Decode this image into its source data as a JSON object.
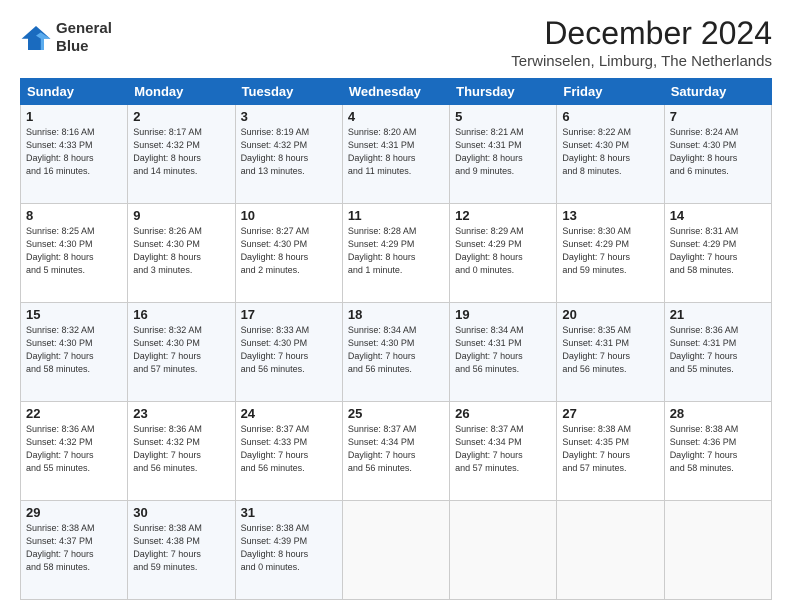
{
  "header": {
    "logo_line1": "General",
    "logo_line2": "Blue",
    "main_title": "December 2024",
    "subtitle": "Terwinselen, Limburg, The Netherlands"
  },
  "calendar": {
    "headers": [
      "Sunday",
      "Monday",
      "Tuesday",
      "Wednesday",
      "Thursday",
      "Friday",
      "Saturday"
    ],
    "weeks": [
      [
        {
          "day": "1",
          "info": "Sunrise: 8:16 AM\nSunset: 4:33 PM\nDaylight: 8 hours\nand 16 minutes."
        },
        {
          "day": "2",
          "info": "Sunrise: 8:17 AM\nSunset: 4:32 PM\nDaylight: 8 hours\nand 14 minutes."
        },
        {
          "day": "3",
          "info": "Sunrise: 8:19 AM\nSunset: 4:32 PM\nDaylight: 8 hours\nand 13 minutes."
        },
        {
          "day": "4",
          "info": "Sunrise: 8:20 AM\nSunset: 4:31 PM\nDaylight: 8 hours\nand 11 minutes."
        },
        {
          "day": "5",
          "info": "Sunrise: 8:21 AM\nSunset: 4:31 PM\nDaylight: 8 hours\nand 9 minutes."
        },
        {
          "day": "6",
          "info": "Sunrise: 8:22 AM\nSunset: 4:30 PM\nDaylight: 8 hours\nand 8 minutes."
        },
        {
          "day": "7",
          "info": "Sunrise: 8:24 AM\nSunset: 4:30 PM\nDaylight: 8 hours\nand 6 minutes."
        }
      ],
      [
        {
          "day": "8",
          "info": "Sunrise: 8:25 AM\nSunset: 4:30 PM\nDaylight: 8 hours\nand 5 minutes."
        },
        {
          "day": "9",
          "info": "Sunrise: 8:26 AM\nSunset: 4:30 PM\nDaylight: 8 hours\nand 3 minutes."
        },
        {
          "day": "10",
          "info": "Sunrise: 8:27 AM\nSunset: 4:30 PM\nDaylight: 8 hours\nand 2 minutes."
        },
        {
          "day": "11",
          "info": "Sunrise: 8:28 AM\nSunset: 4:29 PM\nDaylight: 8 hours\nand 1 minute."
        },
        {
          "day": "12",
          "info": "Sunrise: 8:29 AM\nSunset: 4:29 PM\nDaylight: 8 hours\nand 0 minutes."
        },
        {
          "day": "13",
          "info": "Sunrise: 8:30 AM\nSunset: 4:29 PM\nDaylight: 7 hours\nand 59 minutes."
        },
        {
          "day": "14",
          "info": "Sunrise: 8:31 AM\nSunset: 4:29 PM\nDaylight: 7 hours\nand 58 minutes."
        }
      ],
      [
        {
          "day": "15",
          "info": "Sunrise: 8:32 AM\nSunset: 4:30 PM\nDaylight: 7 hours\nand 58 minutes."
        },
        {
          "day": "16",
          "info": "Sunrise: 8:32 AM\nSunset: 4:30 PM\nDaylight: 7 hours\nand 57 minutes."
        },
        {
          "day": "17",
          "info": "Sunrise: 8:33 AM\nSunset: 4:30 PM\nDaylight: 7 hours\nand 56 minutes."
        },
        {
          "day": "18",
          "info": "Sunrise: 8:34 AM\nSunset: 4:30 PM\nDaylight: 7 hours\nand 56 minutes."
        },
        {
          "day": "19",
          "info": "Sunrise: 8:34 AM\nSunset: 4:31 PM\nDaylight: 7 hours\nand 56 minutes."
        },
        {
          "day": "20",
          "info": "Sunrise: 8:35 AM\nSunset: 4:31 PM\nDaylight: 7 hours\nand 56 minutes."
        },
        {
          "day": "21",
          "info": "Sunrise: 8:36 AM\nSunset: 4:31 PM\nDaylight: 7 hours\nand 55 minutes."
        }
      ],
      [
        {
          "day": "22",
          "info": "Sunrise: 8:36 AM\nSunset: 4:32 PM\nDaylight: 7 hours\nand 55 minutes."
        },
        {
          "day": "23",
          "info": "Sunrise: 8:36 AM\nSunset: 4:32 PM\nDaylight: 7 hours\nand 56 minutes."
        },
        {
          "day": "24",
          "info": "Sunrise: 8:37 AM\nSunset: 4:33 PM\nDaylight: 7 hours\nand 56 minutes."
        },
        {
          "day": "25",
          "info": "Sunrise: 8:37 AM\nSunset: 4:34 PM\nDaylight: 7 hours\nand 56 minutes."
        },
        {
          "day": "26",
          "info": "Sunrise: 8:37 AM\nSunset: 4:34 PM\nDaylight: 7 hours\nand 57 minutes."
        },
        {
          "day": "27",
          "info": "Sunrise: 8:38 AM\nSunset: 4:35 PM\nDaylight: 7 hours\nand 57 minutes."
        },
        {
          "day": "28",
          "info": "Sunrise: 8:38 AM\nSunset: 4:36 PM\nDaylight: 7 hours\nand 58 minutes."
        }
      ],
      [
        {
          "day": "29",
          "info": "Sunrise: 8:38 AM\nSunset: 4:37 PM\nDaylight: 7 hours\nand 58 minutes."
        },
        {
          "day": "30",
          "info": "Sunrise: 8:38 AM\nSunset: 4:38 PM\nDaylight: 7 hours\nand 59 minutes."
        },
        {
          "day": "31",
          "info": "Sunrise: 8:38 AM\nSunset: 4:39 PM\nDaylight: 8 hours\nand 0 minutes."
        },
        {
          "day": "",
          "info": ""
        },
        {
          "day": "",
          "info": ""
        },
        {
          "day": "",
          "info": ""
        },
        {
          "day": "",
          "info": ""
        }
      ]
    ]
  }
}
